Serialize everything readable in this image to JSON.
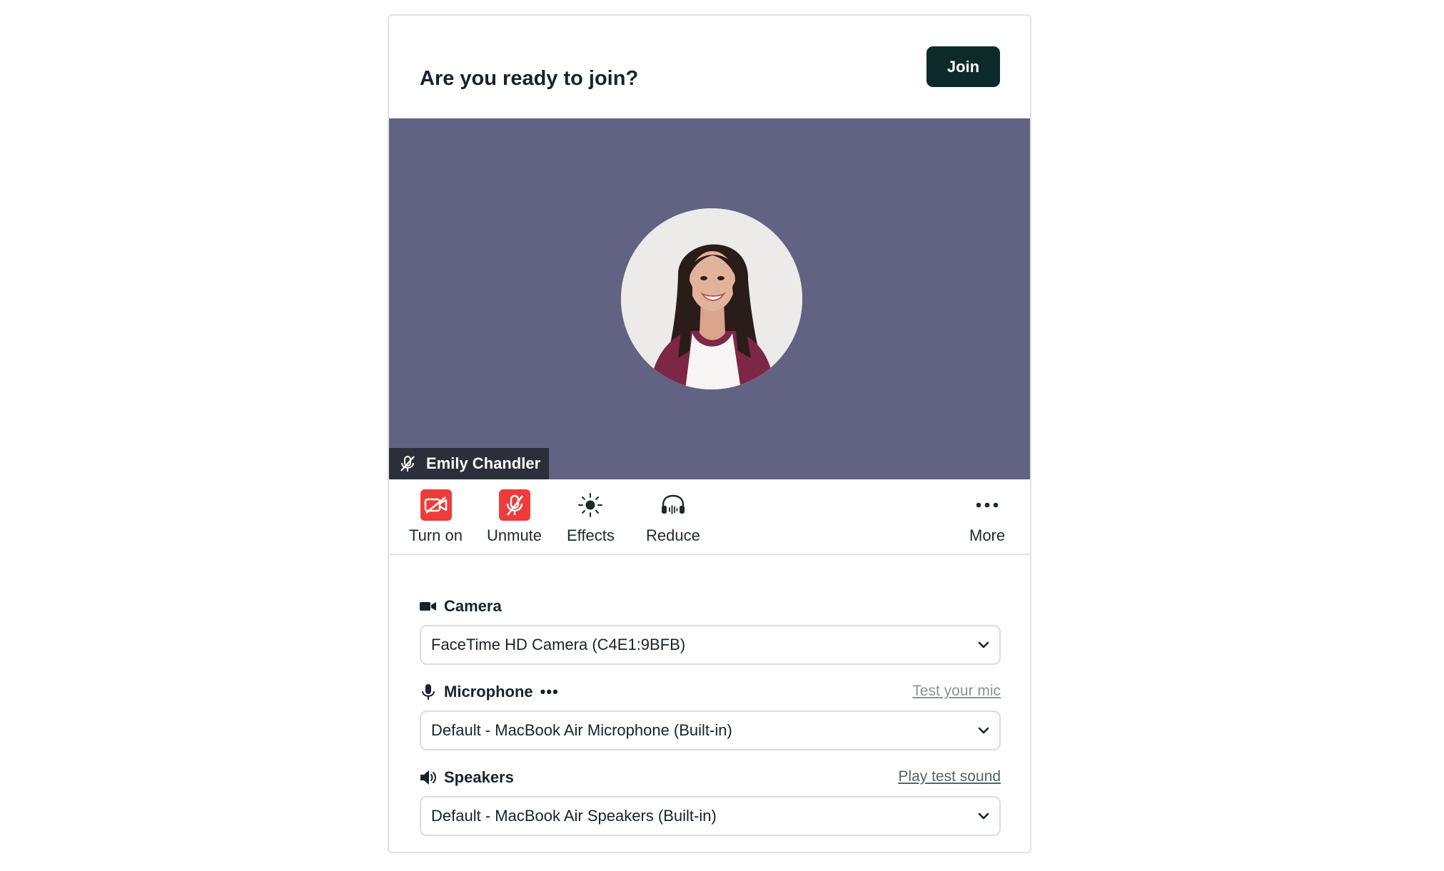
{
  "header": {
    "title": "Are you ready to join?",
    "join_label": "Join"
  },
  "preview": {
    "background": "#626382",
    "participant_name": "Emily Chandler"
  },
  "controls": {
    "camera_label": "Turn on",
    "mic_label": "Unmute",
    "effects_label": "Effects",
    "reduce_label": "Reduce",
    "more_label": "More",
    "danger_color": "#ee3b3b"
  },
  "settings": {
    "camera": {
      "label": "Camera",
      "value": "FaceTime HD Camera (C4E1:9BFB)"
    },
    "microphone": {
      "label": "Microphone",
      "dots": "•••",
      "link": "Test your mic",
      "value": "Default - MacBook Air Microphone (Built-in)"
    },
    "speakers": {
      "label": "Speakers",
      "link": "Play test sound",
      "value": "Default - MacBook Air Speakers (Built-in)"
    }
  }
}
